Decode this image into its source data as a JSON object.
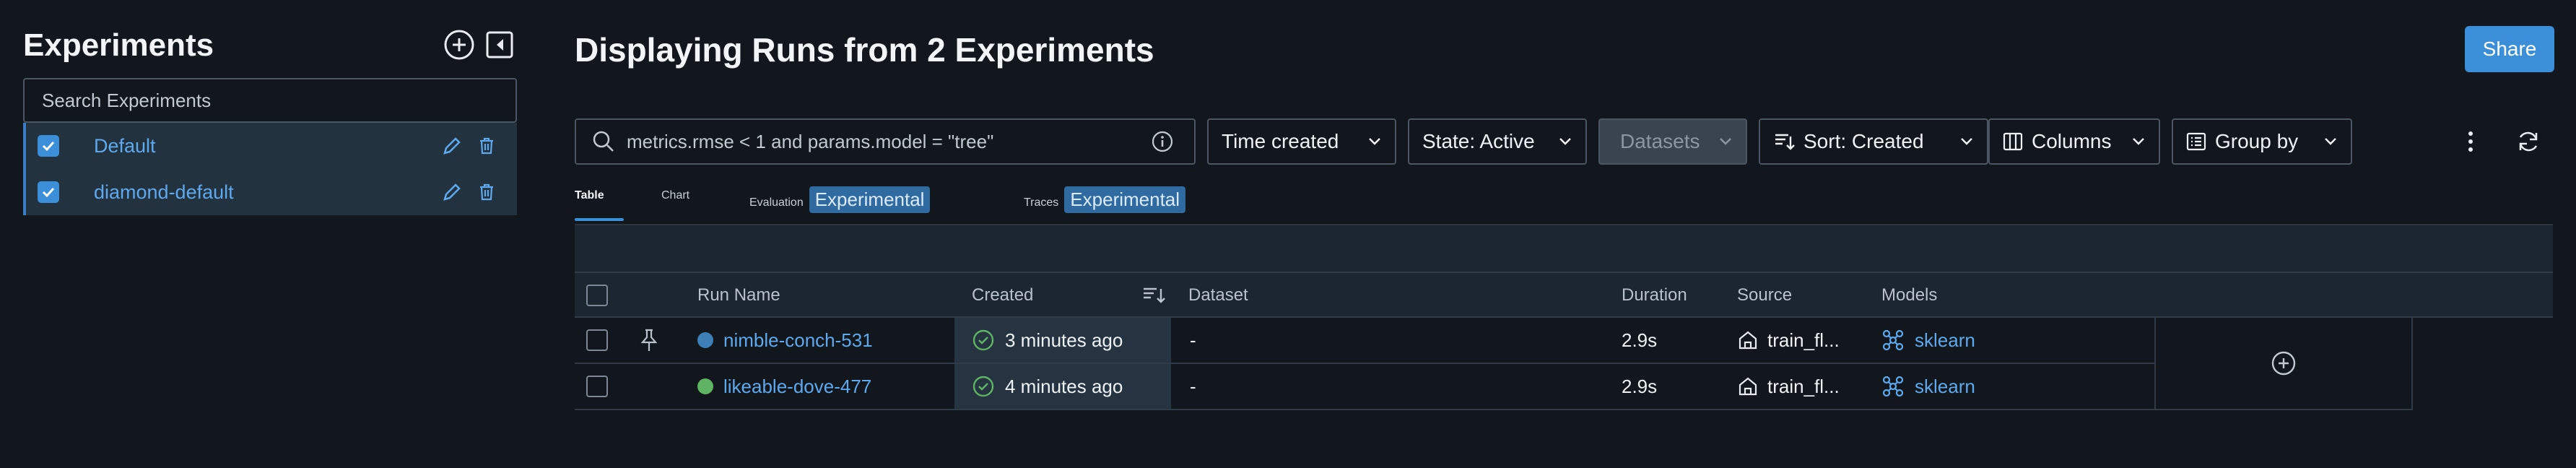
{
  "sidebar": {
    "title": "Experiments",
    "search_placeholder": "Search Experiments",
    "items": [
      {
        "label": "Default",
        "checked": true
      },
      {
        "label": "diamond-default",
        "checked": true
      }
    ]
  },
  "header": {
    "title": "Displaying Runs from 2 Experiments",
    "share_label": "Share"
  },
  "filters": {
    "search_value": "metrics.rmse < 1 and params.model = \"tree\"",
    "time_created": "Time created",
    "state": "State: Active",
    "datasets": "Datasets",
    "sort": "Sort: Created",
    "columns": "Columns",
    "group_by": "Group by"
  },
  "tabs": [
    {
      "label": "Table",
      "active": true
    },
    {
      "label": "Chart"
    },
    {
      "label": "Evaluation",
      "badge": "Experimental"
    },
    {
      "label": "Traces",
      "badge": "Experimental"
    }
  ],
  "table": {
    "headers": {
      "run_name": "Run Name",
      "created": "Created",
      "dataset": "Dataset",
      "duration": "Duration",
      "source": "Source",
      "models": "Models"
    },
    "rows": [
      {
        "run_name": "nimble-conch-531",
        "color": "#3d7fb6",
        "created": "3 minutes ago",
        "dataset": "-",
        "duration": "2.9s",
        "source": "train_fl...",
        "model": "sklearn"
      },
      {
        "run_name": "likeable-dove-477",
        "color": "#5fb463",
        "created": "4 minutes ago",
        "dataset": "-",
        "duration": "2.9s",
        "source": "train_fl...",
        "model": "sklearn"
      }
    ]
  },
  "colors": {
    "accent": "#3b8ed8",
    "link": "#5ea9ee",
    "success": "#5fb463"
  }
}
